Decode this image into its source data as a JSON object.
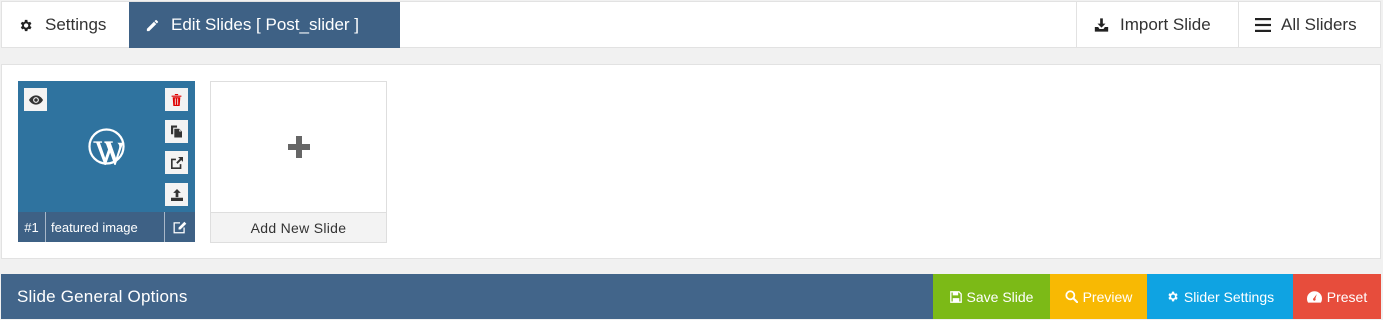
{
  "tabs": {
    "settings": {
      "label": "Settings",
      "icon": "gear-icon"
    },
    "edit_slides": {
      "label": "Edit Slides [ Post_slider ]",
      "icon": "pencil-icon",
      "active": true
    },
    "import_slide": {
      "label": "Import Slide",
      "icon": "download-icon"
    },
    "all_sliders": {
      "label": "All Sliders",
      "icon": "menu-icon"
    }
  },
  "slides": [
    {
      "number": "#1",
      "title": "featured image",
      "thumbnail_icon": "wordpress-logo-icon",
      "actions": [
        "eye-icon",
        "trash-icon",
        "duplicate-icon",
        "share-icon",
        "upload-icon",
        "edit-icon"
      ]
    }
  ],
  "add_slide": {
    "label": "Add New Slide",
    "icon": "plus-icon"
  },
  "options_bar": {
    "title": "Slide General Options",
    "buttons": {
      "save": {
        "label": "Save Slide",
        "icon": "floppy-icon",
        "color": "#7cba17"
      },
      "preview": {
        "label": "Preview",
        "icon": "search-icon",
        "color": "#f8b903"
      },
      "slider_settings": {
        "label": "Slider Settings",
        "icon": "gear-icon",
        "color": "#0fa3e2"
      },
      "preset": {
        "label": "Preset",
        "icon": "dashboard-icon",
        "color": "#e74d3c"
      }
    }
  },
  "colors": {
    "accent": "#3e6185",
    "danger": "#e00000"
  }
}
